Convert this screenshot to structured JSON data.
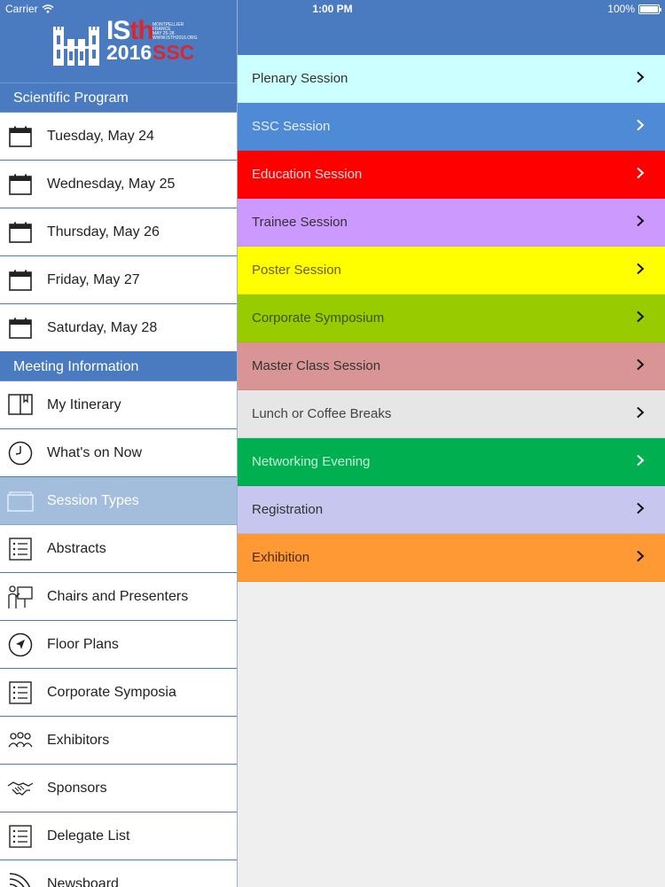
{
  "statusbar": {
    "carrier": "Carrier",
    "time": "1:00 PM",
    "battery": "100%"
  },
  "logo": {
    "is": "IS",
    "th": "th",
    "year": "2016",
    "ssc": "SSC",
    "mini_lines": [
      "MONTPELLIER",
      "FRANCE",
      "MAY 25-28",
      "WWW.ISTH2016.ORG"
    ]
  },
  "sidebar": {
    "scientific_header": "Scientific Program",
    "days": [
      {
        "label": "Tuesday, May 24",
        "icon": "calendar-icon"
      },
      {
        "label": "Wednesday, May 25",
        "icon": "calendar-icon"
      },
      {
        "label": "Thursday, May 26",
        "icon": "calendar-icon"
      },
      {
        "label": "Friday, May 27",
        "icon": "calendar-icon"
      },
      {
        "label": "Saturday, May 28",
        "icon": "calendar-icon"
      }
    ],
    "meeting_header": "Meeting Information",
    "meeting_items": [
      {
        "label": "My Itinerary",
        "icon": "book-icon"
      },
      {
        "label": "What's on Now",
        "icon": "clock-icon"
      },
      {
        "label": "Session Types",
        "icon": "folder-icon",
        "selected": true
      },
      {
        "label": "Abstracts",
        "icon": "list-icon"
      },
      {
        "label": "Chairs and Presenters",
        "icon": "presenter-icon"
      },
      {
        "label": "Floor Plans",
        "icon": "location-arrow-icon"
      },
      {
        "label": "Corporate Symposia",
        "icon": "list-icon"
      },
      {
        "label": "Exhibitors",
        "icon": "people-icon"
      },
      {
        "label": "Sponsors",
        "icon": "handshake-icon"
      },
      {
        "label": "Delegate List",
        "icon": "list-icon"
      },
      {
        "label": "Newsboard",
        "icon": "rss-icon"
      }
    ]
  },
  "sessions": [
    {
      "label": "Plenary Session",
      "bg": "#ccffff",
      "fg": "#333333",
      "chev": "#111111"
    },
    {
      "label": "SSC Session",
      "bg": "#4f8ad6",
      "fg": "#e6efff",
      "chev": "#ffffff"
    },
    {
      "label": "Education Session",
      "bg": "#ff0000",
      "fg": "#ffe0e0",
      "chev": "#ffffff"
    },
    {
      "label": "Trainee Session",
      "bg": "#cc99ff",
      "fg": "#333333",
      "chev": "#111111"
    },
    {
      "label": "Poster Session",
      "bg": "#ffff00",
      "fg": "#775500",
      "chev": "#111111"
    },
    {
      "label": "Corporate Symposium",
      "bg": "#99cc00",
      "fg": "#3d5200",
      "chev": "#111111"
    },
    {
      "label": "Master Class Session",
      "bg": "#d99595",
      "fg": "#333333",
      "chev": "#111111"
    },
    {
      "label": "Lunch or Coffee Breaks",
      "bg": "#e6e6e6",
      "fg": "#444444",
      "chev": "#111111"
    },
    {
      "label": "Networking Evening",
      "bg": "#00b050",
      "fg": "#c8f0d8",
      "chev": "#ffffff"
    },
    {
      "label": "Registration",
      "bg": "#c6c6ee",
      "fg": "#333333",
      "chev": "#111111"
    },
    {
      "label": "Exhibition",
      "bg": "#ff9933",
      "fg": "#4a2a00",
      "chev": "#111111"
    }
  ]
}
